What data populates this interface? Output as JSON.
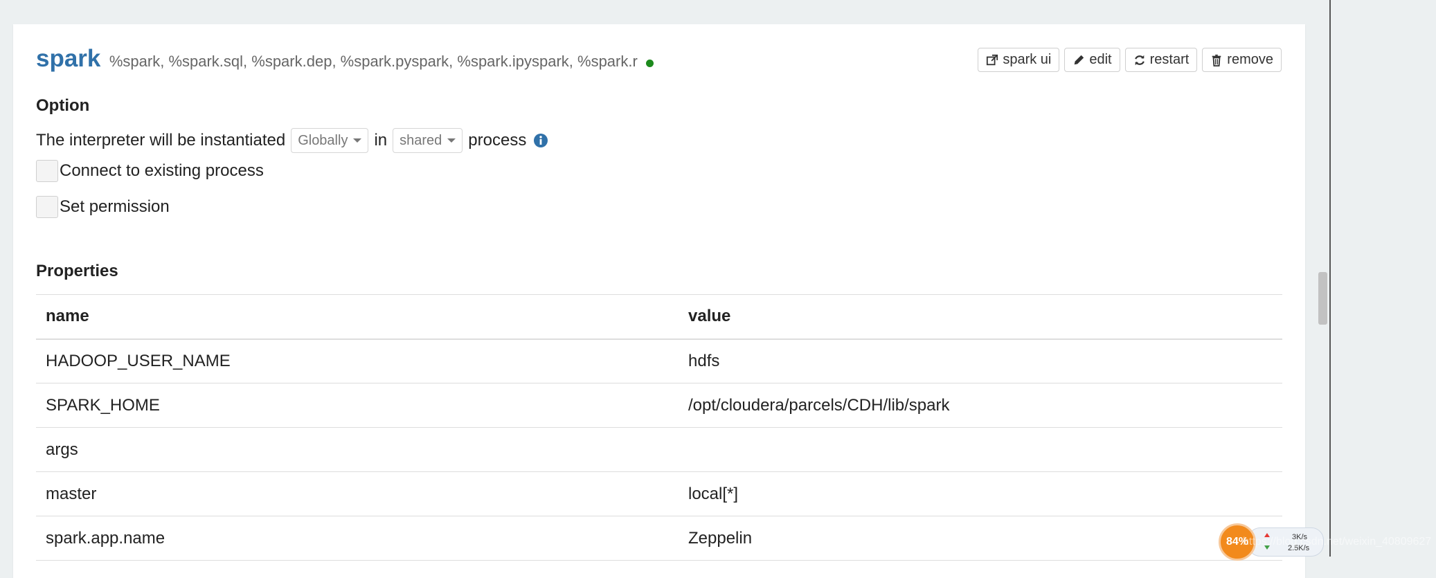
{
  "interpreter": {
    "name": "spark",
    "groups": "%spark, %spark.sql, %spark.dep, %spark.pyspark, %spark.ipyspark, %spark.r",
    "status_color": "#1d8a1d"
  },
  "actions": {
    "spark_ui": "spark ui",
    "edit": "edit",
    "restart": "restart",
    "remove": "remove"
  },
  "option": {
    "title": "Option",
    "sentence_prefix": "The interpreter will be instantiated",
    "scope_value": "Globally",
    "sentence_middle": "in",
    "process_value": "shared",
    "sentence_suffix": "process",
    "connect_existing_label": "Connect to existing process",
    "set_permission_label": "Set permission"
  },
  "properties": {
    "title": "Properties",
    "columns": [
      "name",
      "value"
    ],
    "rows": [
      {
        "name": "HADOOP_USER_NAME",
        "value": "hdfs"
      },
      {
        "name": "SPARK_HOME",
        "value": "/opt/cloudera/parcels/CDH/lib/spark"
      },
      {
        "name": "args",
        "value": ""
      },
      {
        "name": "master",
        "value": "local[*]"
      },
      {
        "name": "spark.app.name",
        "value": "Zeppelin"
      }
    ]
  },
  "system_widget": {
    "percent": "84%",
    "upload": "3K/s",
    "download": "2.5K/s"
  },
  "watermark": "https://blog.csdn.net/weixin_40809627",
  "colors": {
    "accent": "#3071a9",
    "background": "#ecf0f1"
  }
}
